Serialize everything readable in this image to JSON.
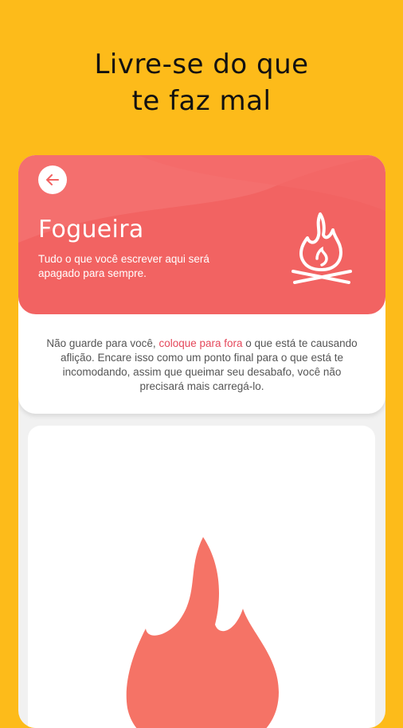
{
  "headline": {
    "line1": "Livre-se do que",
    "line2": "te faz mal"
  },
  "hero": {
    "title": "Fogueira",
    "subtitle": "Tudo o que você escrever aqui será apagado para sempre.",
    "back_icon": "arrow-left-icon",
    "campfire_icon": "campfire-icon"
  },
  "info": {
    "text_before": "Não guarde para você, ",
    "highlight": "coloque para fora",
    "text_after": " o que está te causando aflição. Encare isso como um ponto final para o que está te incomodando, assim que queimar seu desabafo, você não precisará mais carregá-lo."
  },
  "fire": {
    "icon": "flame-icon"
  },
  "colors": {
    "background": "#FDBB1A",
    "hero": "#F26362",
    "highlight": "#E4475A",
    "flame": "#F57366"
  }
}
